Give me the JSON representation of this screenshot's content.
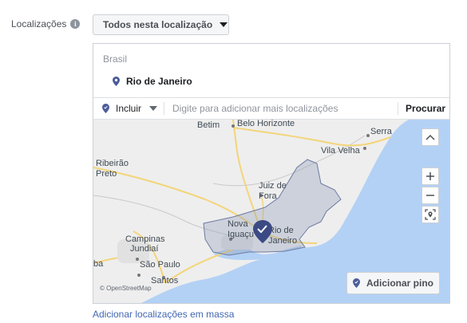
{
  "field": {
    "label": "Localizações",
    "info_icon": "info-icon"
  },
  "mode_dropdown": {
    "value": "Todos nesta localização"
  },
  "selected": {
    "country": "Brasil",
    "location": "Rio de Janeiro"
  },
  "include_bar": {
    "mode": "Incluir",
    "search_placeholder": "Digite para adicionar mais localizações",
    "search_button": "Procurar"
  },
  "map": {
    "cities": {
      "serra": "Serra",
      "betim": "Betim",
      "belo_horizonte": "Belo Horizonte",
      "vila_velha": "Vila Velha",
      "ribeirao": "Ribeirão",
      "preto": "Preto",
      "juiz": "Juiz de",
      "fora": "Fora",
      "nova": "Nova",
      "iguacu": "Iguaçu",
      "rio": "Rio de",
      "janeiro": "Janeiro",
      "campinas": "Campinas",
      "jundiai": "Jundiaí",
      "ba": "ba",
      "sao_paulo": "São Paulo",
      "santos": "Santos"
    },
    "attribution": "© OpenStreetMap",
    "add_pin_label": "Adicionar pino",
    "colors": {
      "water": "#b3d1f5",
      "land": "#eeeeee",
      "region": "#8f9cb8",
      "pin": "#3b4a84"
    }
  },
  "bulk_link": "Adicionar localizações em massa"
}
